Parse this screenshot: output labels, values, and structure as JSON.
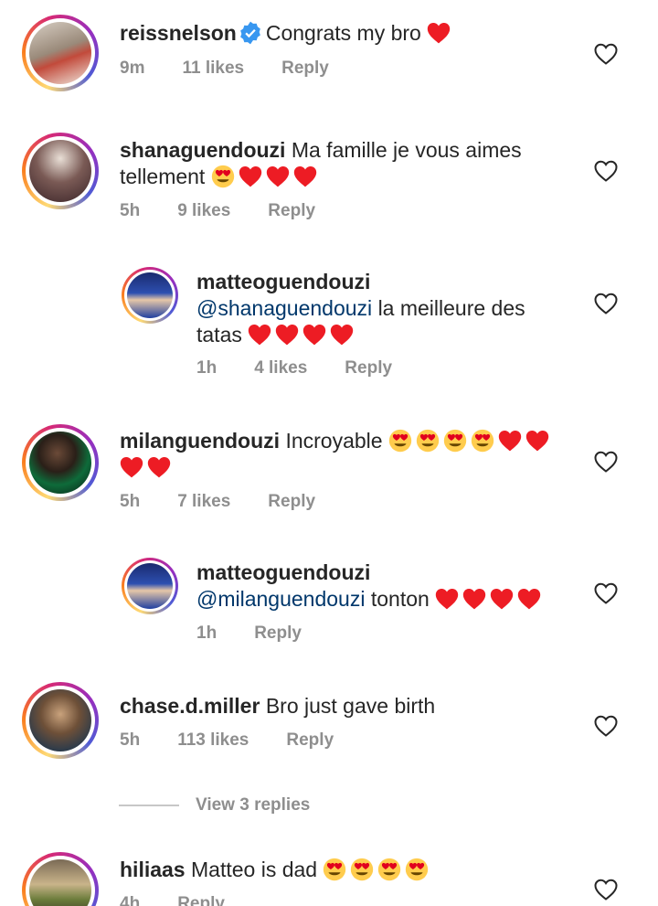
{
  "comments": [
    {
      "username": "reissnelson",
      "verified": true,
      "text": "Congrats my bro",
      "emoji": [
        "red-heart"
      ],
      "time": "9m",
      "likes": "11 likes",
      "reply": "Reply"
    },
    {
      "username": "shanaguendouzi",
      "text": "Ma famille je vous aimes tellement",
      "emoji": [
        "heart-eyes",
        "red-heart",
        "red-heart",
        "red-heart"
      ],
      "time": "5h",
      "likes": "9 likes",
      "reply": "Reply"
    },
    {
      "username": "matteoguendouzi",
      "mention": "@shanaguendouzi",
      "text": "la meilleure des tatas",
      "emoji": [
        "red-heart",
        "red-heart",
        "red-heart",
        "red-heart"
      ],
      "time": "1h",
      "likes": "4 likes",
      "reply": "Reply"
    },
    {
      "username": "milanguendouzi",
      "text": "Incroyable",
      "emoji": [
        "heart-eyes",
        "heart-eyes",
        "heart-eyes",
        "heart-eyes",
        "red-heart",
        "red-heart",
        "red-heart",
        "red-heart"
      ],
      "time": "5h",
      "likes": "7 likes",
      "reply": "Reply"
    },
    {
      "username": "matteoguendouzi",
      "mention": "@milanguendouzi",
      "text": "tonton",
      "emoji": [
        "red-heart",
        "red-heart",
        "red-heart",
        "red-heart"
      ],
      "time": "1h",
      "reply": "Reply"
    },
    {
      "username": "chase.d.miller",
      "text": "Bro just gave birth",
      "time": "5h",
      "likes": "113 likes",
      "reply": "Reply"
    },
    {
      "username": "hiliaas",
      "text": "Matteo is dad",
      "emoji": [
        "heart-eyes",
        "heart-eyes",
        "heart-eyes",
        "heart-eyes"
      ],
      "time": "4h",
      "reply": "Reply"
    }
  ],
  "view_replies": "View 3 replies",
  "icons": {
    "like": "heart-outline-icon",
    "verified": "verified-badge-icon"
  },
  "colors": {
    "text": "#262626",
    "meta": "#8e8e8e",
    "mention": "#00376b",
    "heart": "#ed1c24",
    "verified": "#3897f0"
  }
}
